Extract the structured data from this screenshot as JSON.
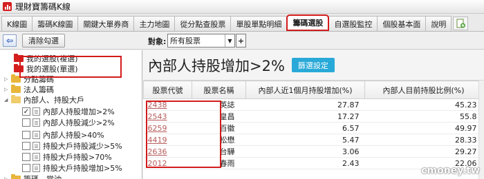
{
  "window": {
    "title": "理財寶籌碼K線"
  },
  "tabs": [
    {
      "label": "K線圖",
      "active": false
    },
    {
      "label": "籌碼K線圖",
      "active": false
    },
    {
      "label": "關鍵大單券商",
      "active": false
    },
    {
      "label": "主力地圖",
      "active": false
    },
    {
      "label": "從分點查股票",
      "active": false
    },
    {
      "label": "單股單點明細",
      "active": false
    },
    {
      "label": "籌碼選股",
      "active": true
    },
    {
      "label": "自選股監控",
      "active": false
    },
    {
      "label": "個股基本面",
      "active": false
    },
    {
      "label": "說明",
      "active": false
    }
  ],
  "toolbar": {
    "clear_label": "清除勾選",
    "target_label": "對象:",
    "target_value": "所有股票",
    "plus_label": "+"
  },
  "tree": [
    {
      "label": "我的選股(複選)",
      "type": "folder-red"
    },
    {
      "label": "我的選股(單選)",
      "type": "folder-red"
    },
    {
      "label": "分點籌碼",
      "type": "folder-yellow"
    },
    {
      "label": "法人籌碼",
      "type": "folder-yellow"
    },
    {
      "label": "內部人、持股大戶",
      "type": "folder-open"
    },
    {
      "label": "內部人持股增加>2%",
      "checked": true
    },
    {
      "label": "內部人持股減少>2%",
      "checked": false
    },
    {
      "label": "內部人持股>40%",
      "checked": false
    },
    {
      "label": "持股大戶持股減少>5%",
      "checked": false
    },
    {
      "label": "持股大戶持股>70%",
      "checked": false
    },
    {
      "label": "持股大戶持股增加>5%",
      "checked": false
    },
    {
      "label": "籌碼、當沖",
      "type": "folder-yellow"
    }
  ],
  "main": {
    "title": "內部人持股增加>2%",
    "filter_button": "篩選設定",
    "columns": [
      "股票代號",
      "股票名稱",
      "內部人近1個月持股增加(%)",
      "內部人目前持股比例(%)"
    ],
    "rows": [
      {
        "code": "2438",
        "name": "英誌",
        "increase": "27.87",
        "ratio": "45.23"
      },
      {
        "code": "2543",
        "name": "皇昌",
        "increase": "17.27",
        "ratio": "55.8"
      },
      {
        "code": "6259",
        "name": "百徽",
        "increase": "6.57",
        "ratio": "49.97"
      },
      {
        "code": "4419",
        "name": "松懋",
        "increase": "5.47",
        "ratio": "28.33"
      },
      {
        "code": "2636",
        "name": "台驊",
        "increase": "3.06",
        "ratio": "29.27"
      },
      {
        "code": "2012",
        "name": "春雨",
        "increase": "2.43",
        "ratio": "22.06"
      }
    ]
  },
  "watermark": "cmoney.tw",
  "colors": {
    "highlight": "#d31a1a",
    "button": "#29a9d8",
    "code_link": "#b85b5b"
  }
}
